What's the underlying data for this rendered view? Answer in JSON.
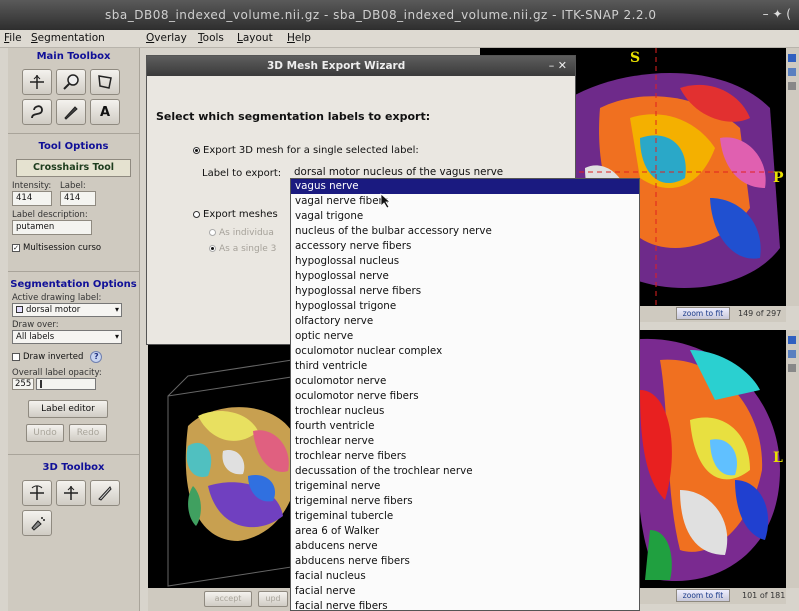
{
  "window": {
    "title": "sba_DB08_indexed_volume.nii.gz - sba_DB08_indexed_volume.nii.gz - ITK-SNAP 2.2.0",
    "controls": "– ✦ ("
  },
  "menubar": {
    "items": [
      "File",
      "Segmentation",
      "Overlay",
      "Tools",
      "Layout",
      "Help"
    ]
  },
  "main_toolbox": {
    "title": "Main Toolbox",
    "tools": [
      "crosshairs-icon",
      "zoom-icon",
      "polygon-icon",
      "snake-icon",
      "paintbrush-icon",
      "annotation-icon"
    ],
    "annotation_glyph": "A"
  },
  "tool_options": {
    "title": "Tool Options",
    "tool_name": "Crosshairs Tool",
    "intensity_label": "Intensity:",
    "label_label": "Label:",
    "intensity_value": "414",
    "label_value": "414",
    "label_description_label": "Label description:",
    "label_description": "putamen",
    "multisession": "Multisession curso"
  },
  "segmentation_options": {
    "title": "Segmentation Options",
    "active_label_caption": "Active drawing label:",
    "active_label": "dorsal motor",
    "draw_over_caption": "Draw over:",
    "draw_over": "All labels",
    "draw_inverted": "Draw inverted",
    "help": "?",
    "opacity_caption": "Overall label opacity:",
    "opacity_value": "255",
    "label_editor": "Label editor",
    "undo": "Undo",
    "redo": "Redo"
  },
  "toolbox_3d": {
    "title": "3D Toolbox"
  },
  "viewports": {
    "top_right": {
      "zoom": "zoom to fit",
      "slice": "149 of 297",
      "orient_top": "S",
      "orient_right": "P"
    },
    "bottom_right": {
      "zoom": "zoom to fit",
      "slice": "101 of 181",
      "orient_right": "L"
    },
    "bottom_left": {
      "accept": "accept",
      "update": "upd"
    }
  },
  "dialog": {
    "title": "3D Mesh Export Wizard",
    "close": "– ✕",
    "question": "Select which segmentation labels to export:",
    "option_single": "Export 3D mesh for a single selected label:",
    "label_to_export_caption": "Label to export:",
    "option_multi": "Export meshes",
    "sub_individual": "As individua",
    "sub_single": "As a single 3"
  },
  "dropdown": {
    "current": "dorsal motor nucleus of the vagus nerve",
    "selected_index": 0,
    "items": [
      "vagus nerve",
      "vagal nerve fibers",
      "vagal trigone",
      "nucleus of the bulbar accessory nerve",
      "accessory nerve fibers",
      "hypoglossal nucleus",
      "hypoglossal nerve",
      "hypoglossal nerve fibers",
      "hypoglossal trigone",
      "olfactory nerve",
      "optic nerve",
      "oculomotor nuclear complex",
      "third ventricle",
      "oculomotor nerve",
      "oculomotor nerve fibers",
      "trochlear nucleus",
      "fourth ventricle",
      "trochlear nerve",
      "trochlear nerve fibers",
      "decussation of the trochlear nerve",
      "trigeminal nerve",
      "trigeminal nerve fibers",
      "trigeminal tubercle",
      "area 6 of Walker",
      "abducens nerve",
      "abducens nerve fibers",
      "facial nucleus",
      "facial nerve",
      "facial nerve fibers"
    ]
  },
  "colors": {
    "accent_title": "#101098",
    "selection": "#1a1a80",
    "orientation_marker": "#e8e000",
    "crosshair": "#e02020"
  }
}
